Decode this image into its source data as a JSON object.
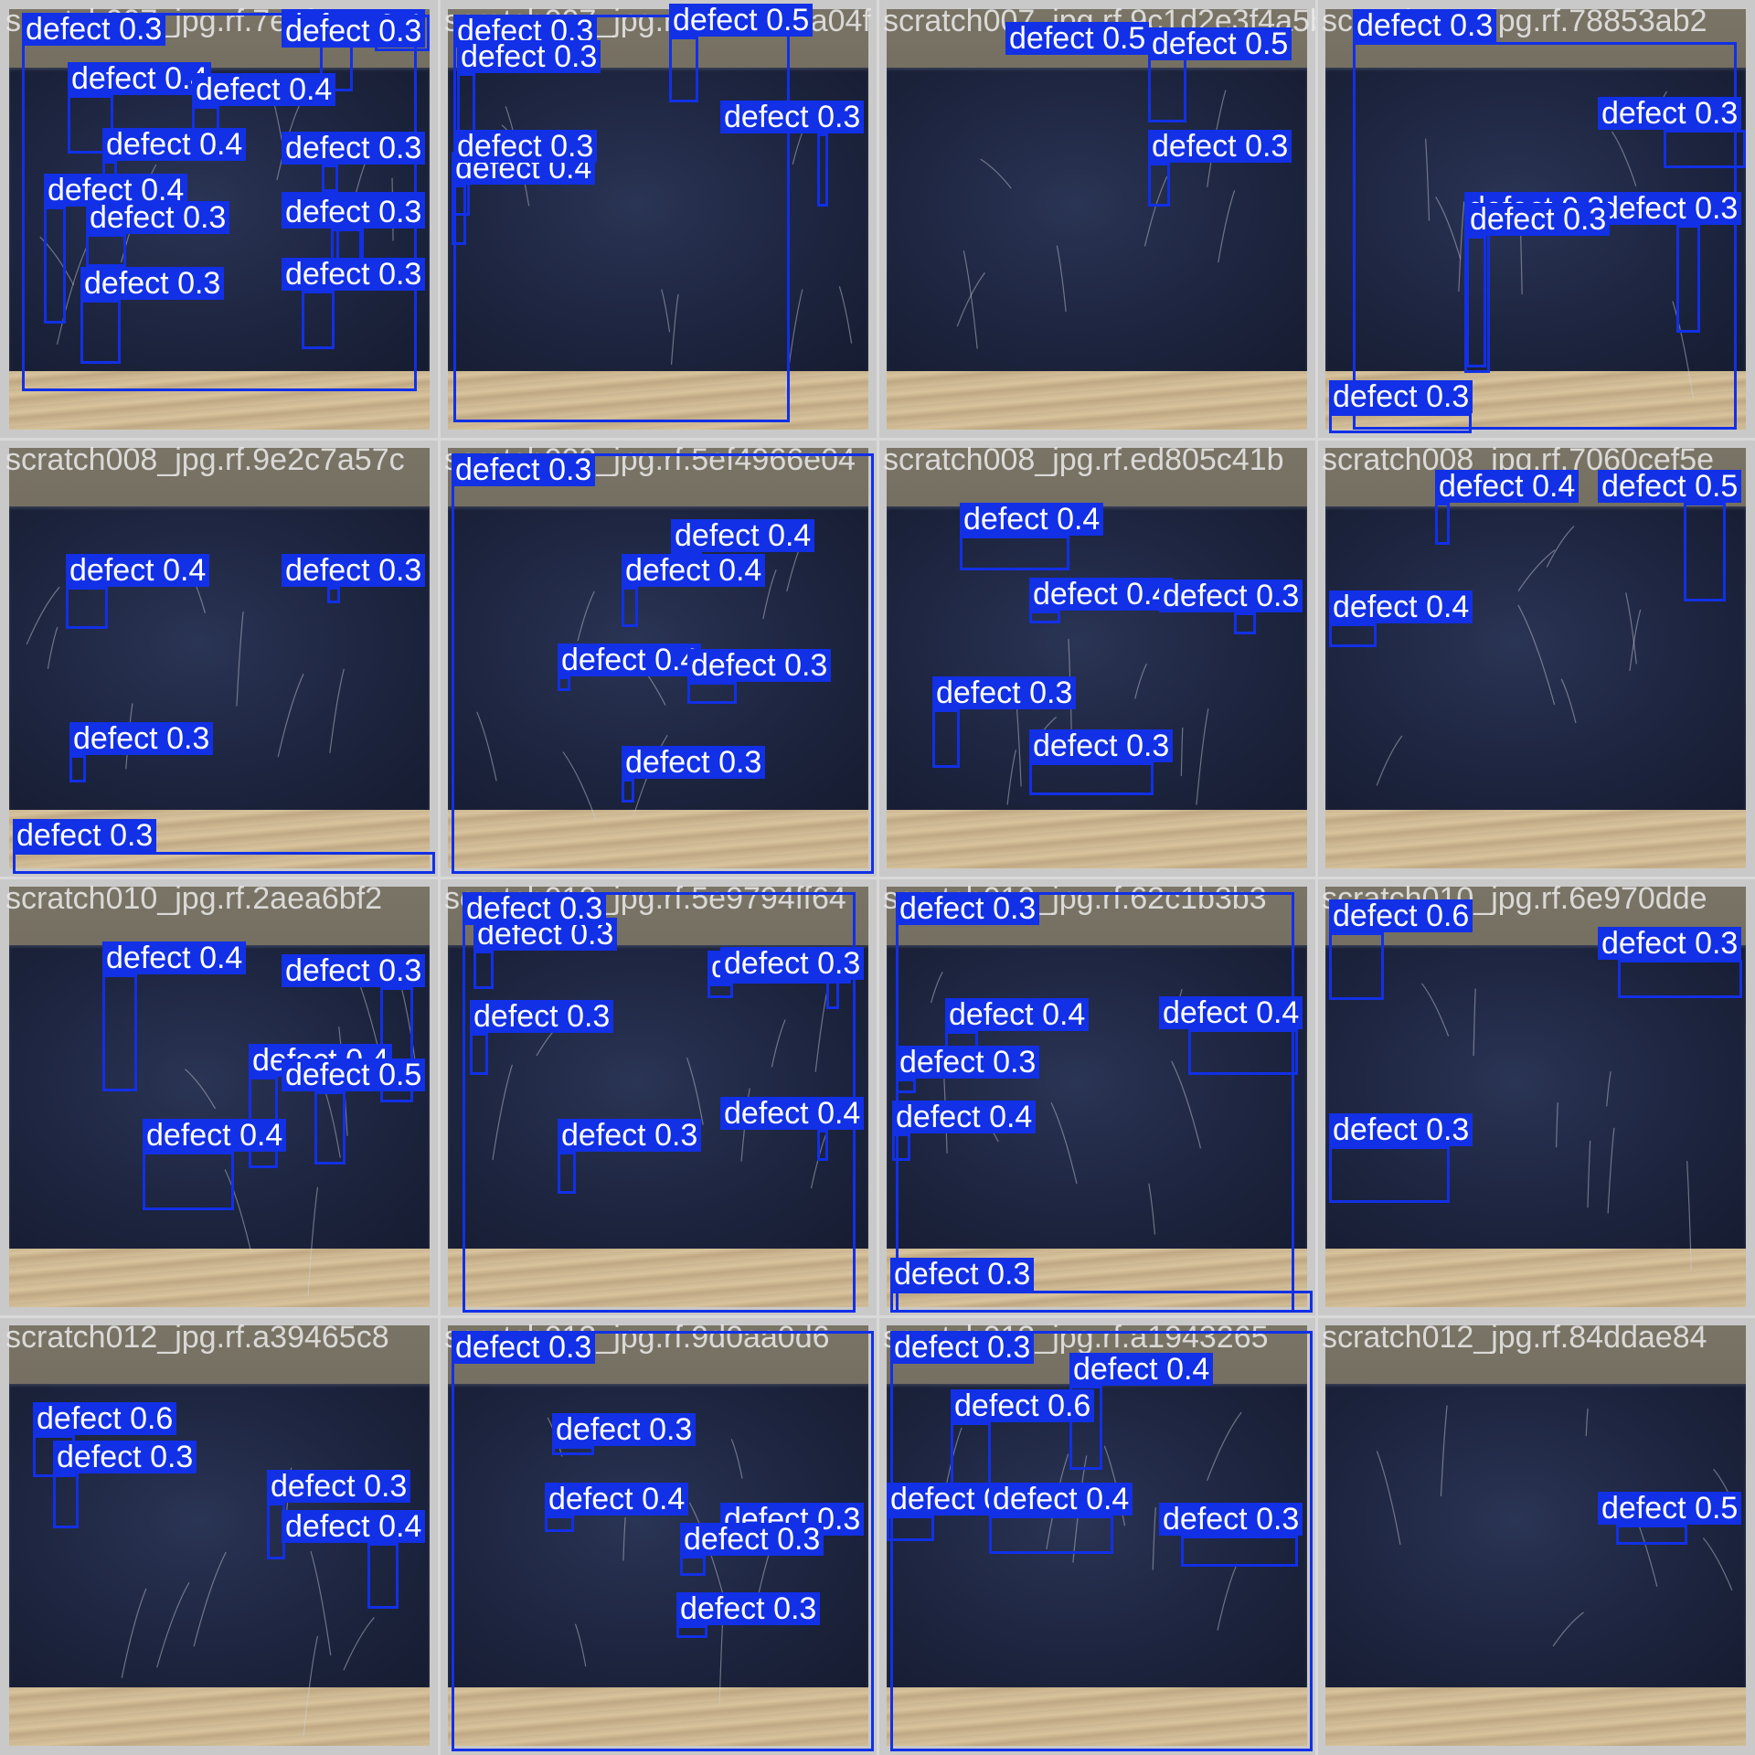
{
  "tiles": [
    {
      "caption": "scratch007_jpg.rf.7e2fe3277",
      "labels": [
        "defect 0.3",
        "defect 0.4",
        "defect 0.4",
        "defect 0.4",
        "defect 0.4",
        "defect 0.4",
        "defect 0.3",
        "defect 0.3",
        "defect 0.3",
        "defect 0.3",
        "defect 0.4",
        "defect 0.3",
        "defect 0.3"
      ]
    },
    {
      "caption": "scratch007_jpg.rf.7b8c4d5a04f",
      "labels": [
        "defect 0.3",
        "defect 0.5",
        "defect 0.3",
        "defect 0.4",
        "defect 0.3",
        "defect 0.3"
      ]
    },
    {
      "caption": "scratch007_jpg.rf.9c1d2e3f4a5b",
      "labels": [
        "defect 0.5",
        "defect 0.5",
        "defect 0.3"
      ]
    },
    {
      "caption": "scratch007_jpg.rf.78853ab2",
      "labels": [
        "defect 0.3",
        "defect 0.3",
        "defect 0.3",
        "defect 0.3",
        "defect 0.3",
        "defect 0.3"
      ]
    },
    {
      "caption": "scratch008_jpg.rf.9e2c7a57c",
      "labels": [
        "defect 0.4",
        "defect 0.3",
        "defect 0.3",
        "defect 0.3"
      ]
    },
    {
      "caption": "scratch008_jpg.rf.5ef4966e04",
      "labels": [
        "defect 0.3",
        "defect 0.4",
        "defect 0.4",
        "defect 0.4",
        "defect 0.3",
        "defect 0.3"
      ]
    },
    {
      "caption": "scratch008_jpg.rf.ed805c41b",
      "labels": [
        "defect 0.4",
        "defect 0.4",
        "defect 0.3",
        "defect 0.3",
        "defect 0.3"
      ]
    },
    {
      "caption": "scratch008_jpg.rf.7060cef5e",
      "labels": [
        "defect 0.4",
        "defect 0.5",
        "defect 0.4"
      ]
    },
    {
      "caption": "scratch010_jpg.rf.2aea6bf2",
      "labels": [
        "defect 0.4",
        "defect 0.3",
        "defect 0.4",
        "defect 0.5",
        "defect 0.4"
      ]
    },
    {
      "caption": "scratch010_jpg.rf.5e9794ff64",
      "labels": [
        "defect 0.3",
        "defect 0.3",
        "defect 0.3",
        "defect 0.3",
        "defect 0.4",
        "defect 0.3",
        "defect 0.3"
      ]
    },
    {
      "caption": "scratch010_jpg.rf.62c1b3b3",
      "labels": [
        "defect 0.4",
        "defect 0.4",
        "defect 0.3",
        "defect 0.4",
        "defect 0.3",
        "defect 0.3"
      ]
    },
    {
      "caption": "scratch010_jpg.rf.6e970dde",
      "labels": [
        "defect 0.6",
        "defect 0.3",
        "defect 0.3"
      ]
    },
    {
      "caption": "scratch012_jpg.rf.a39465c8",
      "labels": [
        "defect 0.6",
        "defect 0.3",
        "defect 0.3",
        "defect 0.4"
      ]
    },
    {
      "caption": "scratch013_jpg.rf.9d0aa0d6",
      "labels": [
        "defect 0.3",
        "defect 0.3",
        "defect 0.4",
        "defect 0.3",
        "defect 0.3",
        "defect 0.3"
      ]
    },
    {
      "caption": "scratch013_jpg.rf.a1943265",
      "labels": [
        "defect 0.3",
        "defect 0.4",
        "defect 0.6",
        "defect 0.3",
        "defect 0.4",
        "defect 0.3"
      ]
    },
    {
      "caption": "scratch012_jpg.rf.84ddae84",
      "labels": [
        "defect 0.5"
      ]
    }
  ],
  "colors": {
    "box": "#1230e6",
    "label_text": "#ffffff",
    "caption": "#ebebeb"
  }
}
